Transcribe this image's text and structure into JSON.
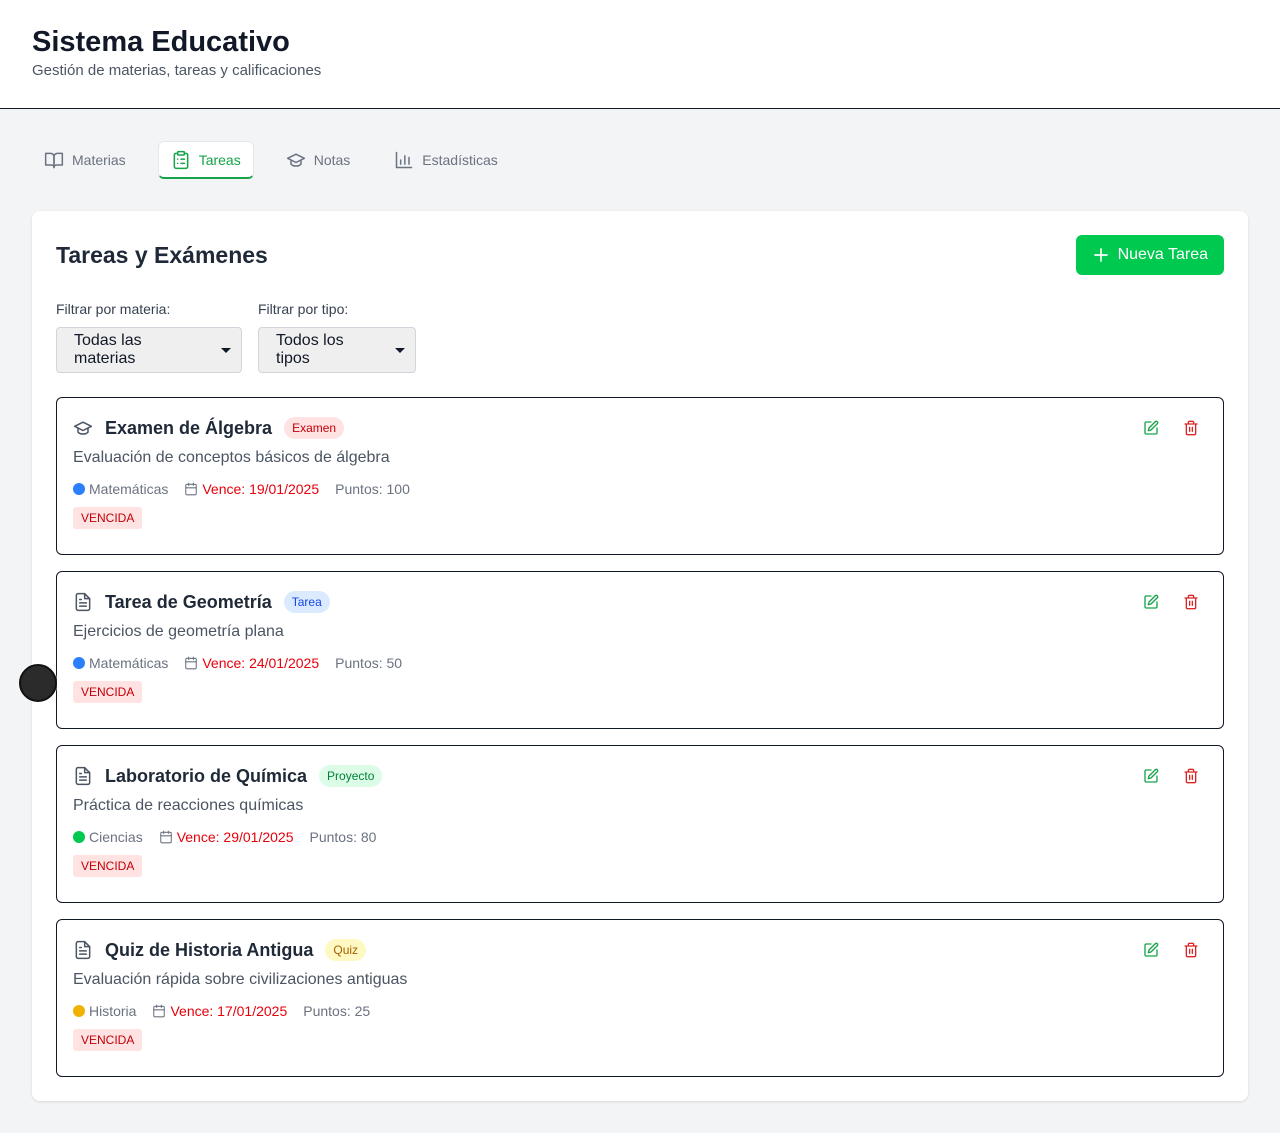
{
  "header": {
    "title": "Sistema Educativo",
    "subtitle": "Gestión de materias, tareas y calificaciones"
  },
  "tabs": [
    {
      "label": "Materias",
      "icon": "book-icon",
      "active": false
    },
    {
      "label": "Tareas",
      "icon": "clipboard-icon",
      "active": true
    },
    {
      "label": "Notas",
      "icon": "graduation-cap-icon",
      "active": false
    },
    {
      "label": "Estadísticas",
      "icon": "bar-chart-icon",
      "active": false
    }
  ],
  "main": {
    "title": "Tareas y Exámenes",
    "new_button_label": "Nueva Tarea",
    "filters": {
      "materia_label": "Filtrar por materia:",
      "materia_value": "Todas las materias",
      "tipo_label": "Filtrar por tipo:",
      "tipo_value": "Todos los tipos"
    },
    "tasks": [
      {
        "title": "Examen de Álgebra",
        "type": "Examen",
        "icon": "graduation-cap-icon",
        "description": "Evaluación de conceptos básicos de álgebra",
        "subject": "Matemáticas",
        "subject_color": "#2b7fff",
        "due": "Vence: 19/01/2025",
        "points": "Puntos: 100",
        "status": "VENCIDA"
      },
      {
        "title": "Tarea de Geometría",
        "type": "Tarea",
        "icon": "file-text-icon",
        "description": "Ejercicios de geometría plana",
        "subject": "Matemáticas",
        "subject_color": "#2b7fff",
        "due": "Vence: 24/01/2025",
        "points": "Puntos: 50",
        "status": "VENCIDA"
      },
      {
        "title": "Laboratorio de Química",
        "type": "Proyecto",
        "icon": "file-text-icon",
        "description": "Práctica de reacciones químicas",
        "subject": "Ciencias",
        "subject_color": "#00c950",
        "due": "Vence: 29/01/2025",
        "points": "Puntos: 80",
        "status": "VENCIDA"
      },
      {
        "title": "Quiz de Historia Antigua",
        "type": "Quiz",
        "icon": "file-text-icon",
        "description": "Evaluación rápida sobre civilizaciones antiguas",
        "subject": "Historia",
        "subject_color": "#f0b100",
        "due": "Vence: 17/01/2025",
        "points": "Puntos: 25",
        "status": "VENCIDA"
      }
    ]
  },
  "badge_colors": {
    "Examen": {
      "bg": "#ffe2e2",
      "fg": "#c10007"
    },
    "Tarea": {
      "bg": "#dbeafe",
      "fg": "#1447e6"
    },
    "Proyecto": {
      "bg": "#dcfce7",
      "fg": "#008236"
    },
    "Quiz": {
      "bg": "#fef9c2",
      "fg": "#a65f00"
    }
  },
  "colors": {
    "accent": "#00c950",
    "danger": "#e7000b"
  }
}
